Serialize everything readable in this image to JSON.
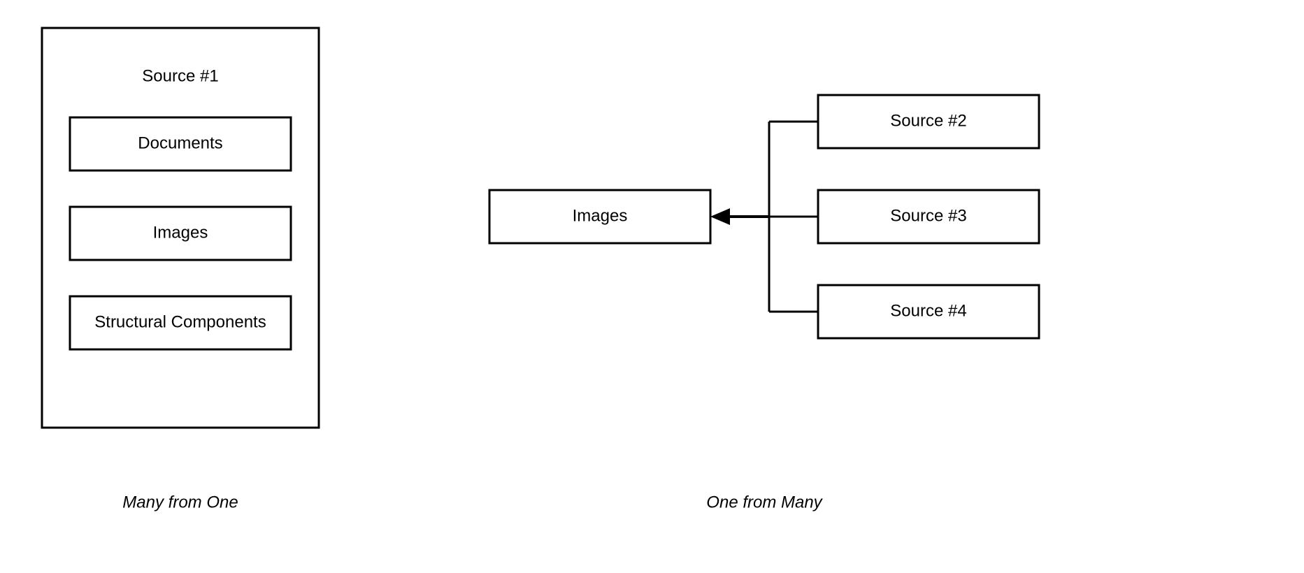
{
  "left": {
    "container_title": "Source #1",
    "inner_boxes": [
      "Documents",
      "Images",
      "Structural Components"
    ],
    "caption": "Many from One"
  },
  "right": {
    "target_box": "Images",
    "source_boxes": [
      "Source #2",
      "Source #3",
      "Source #4"
    ],
    "caption": "One from Many"
  }
}
